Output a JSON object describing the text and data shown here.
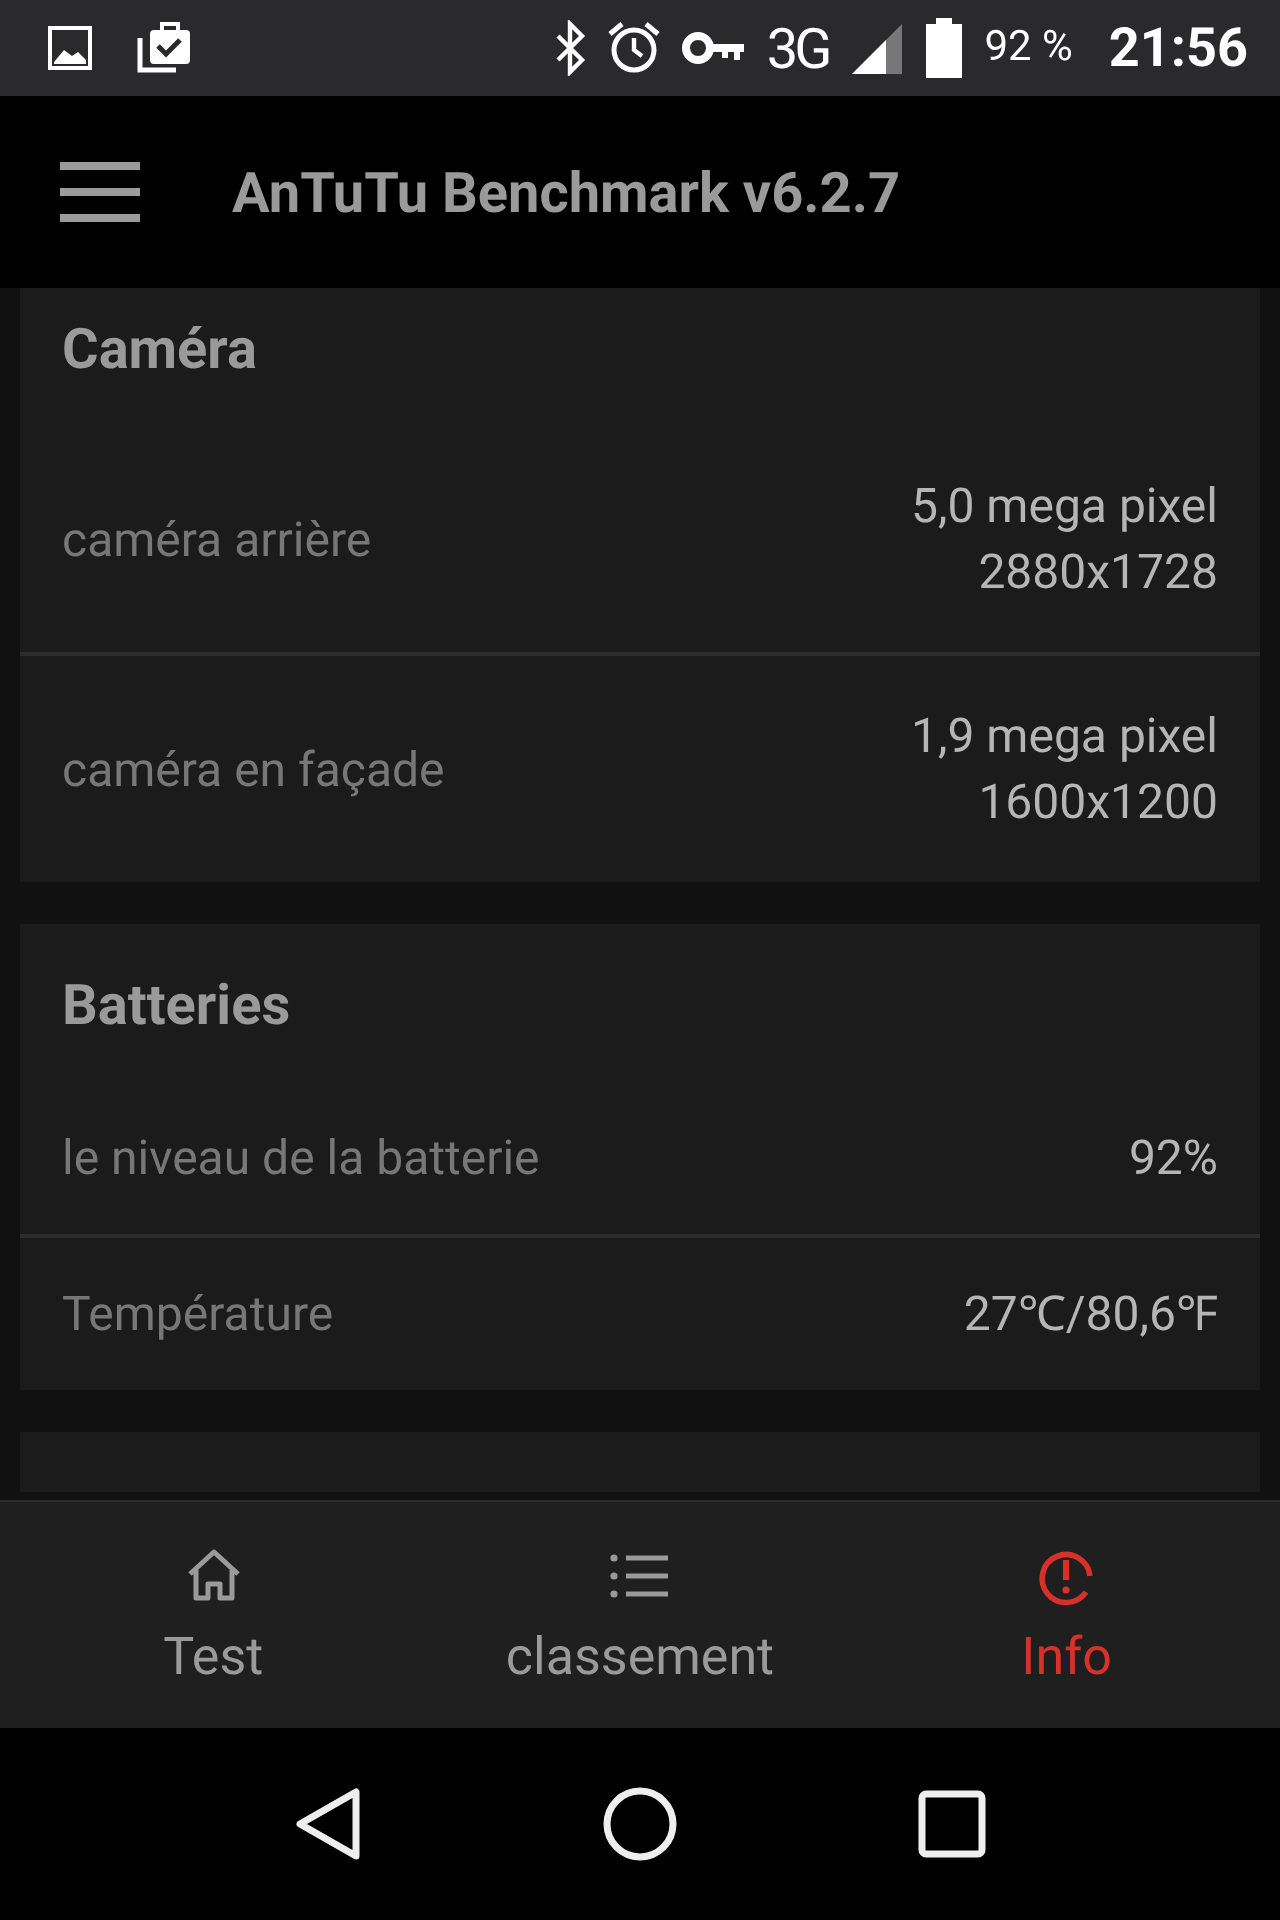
{
  "status_bar": {
    "time": "21:56",
    "battery_text": "92 %",
    "network": "3G"
  },
  "app_bar": {
    "title": "AnTuTu Benchmark v6.2.7"
  },
  "sections": [
    {
      "title": "Caméra",
      "rows": [
        {
          "label": "caméra arrière",
          "value_lines": [
            "5,0 mega pixel",
            "2880x1728"
          ]
        },
        {
          "label": "caméra en façade",
          "value_lines": [
            "1,9 mega pixel",
            "1600x1200"
          ]
        }
      ]
    },
    {
      "title": "Batteries",
      "rows": [
        {
          "label": "le niveau de la batterie",
          "value_lines": [
            "92%"
          ]
        },
        {
          "label": "Température",
          "value_lines": [
            "27℃/80,6℉"
          ]
        }
      ]
    }
  ],
  "bottom_nav": [
    {
      "kind": "home",
      "label": "Test",
      "selected": false
    },
    {
      "kind": "list",
      "label": "classement",
      "selected": false
    },
    {
      "kind": "info",
      "label": "Info",
      "selected": true
    }
  ]
}
